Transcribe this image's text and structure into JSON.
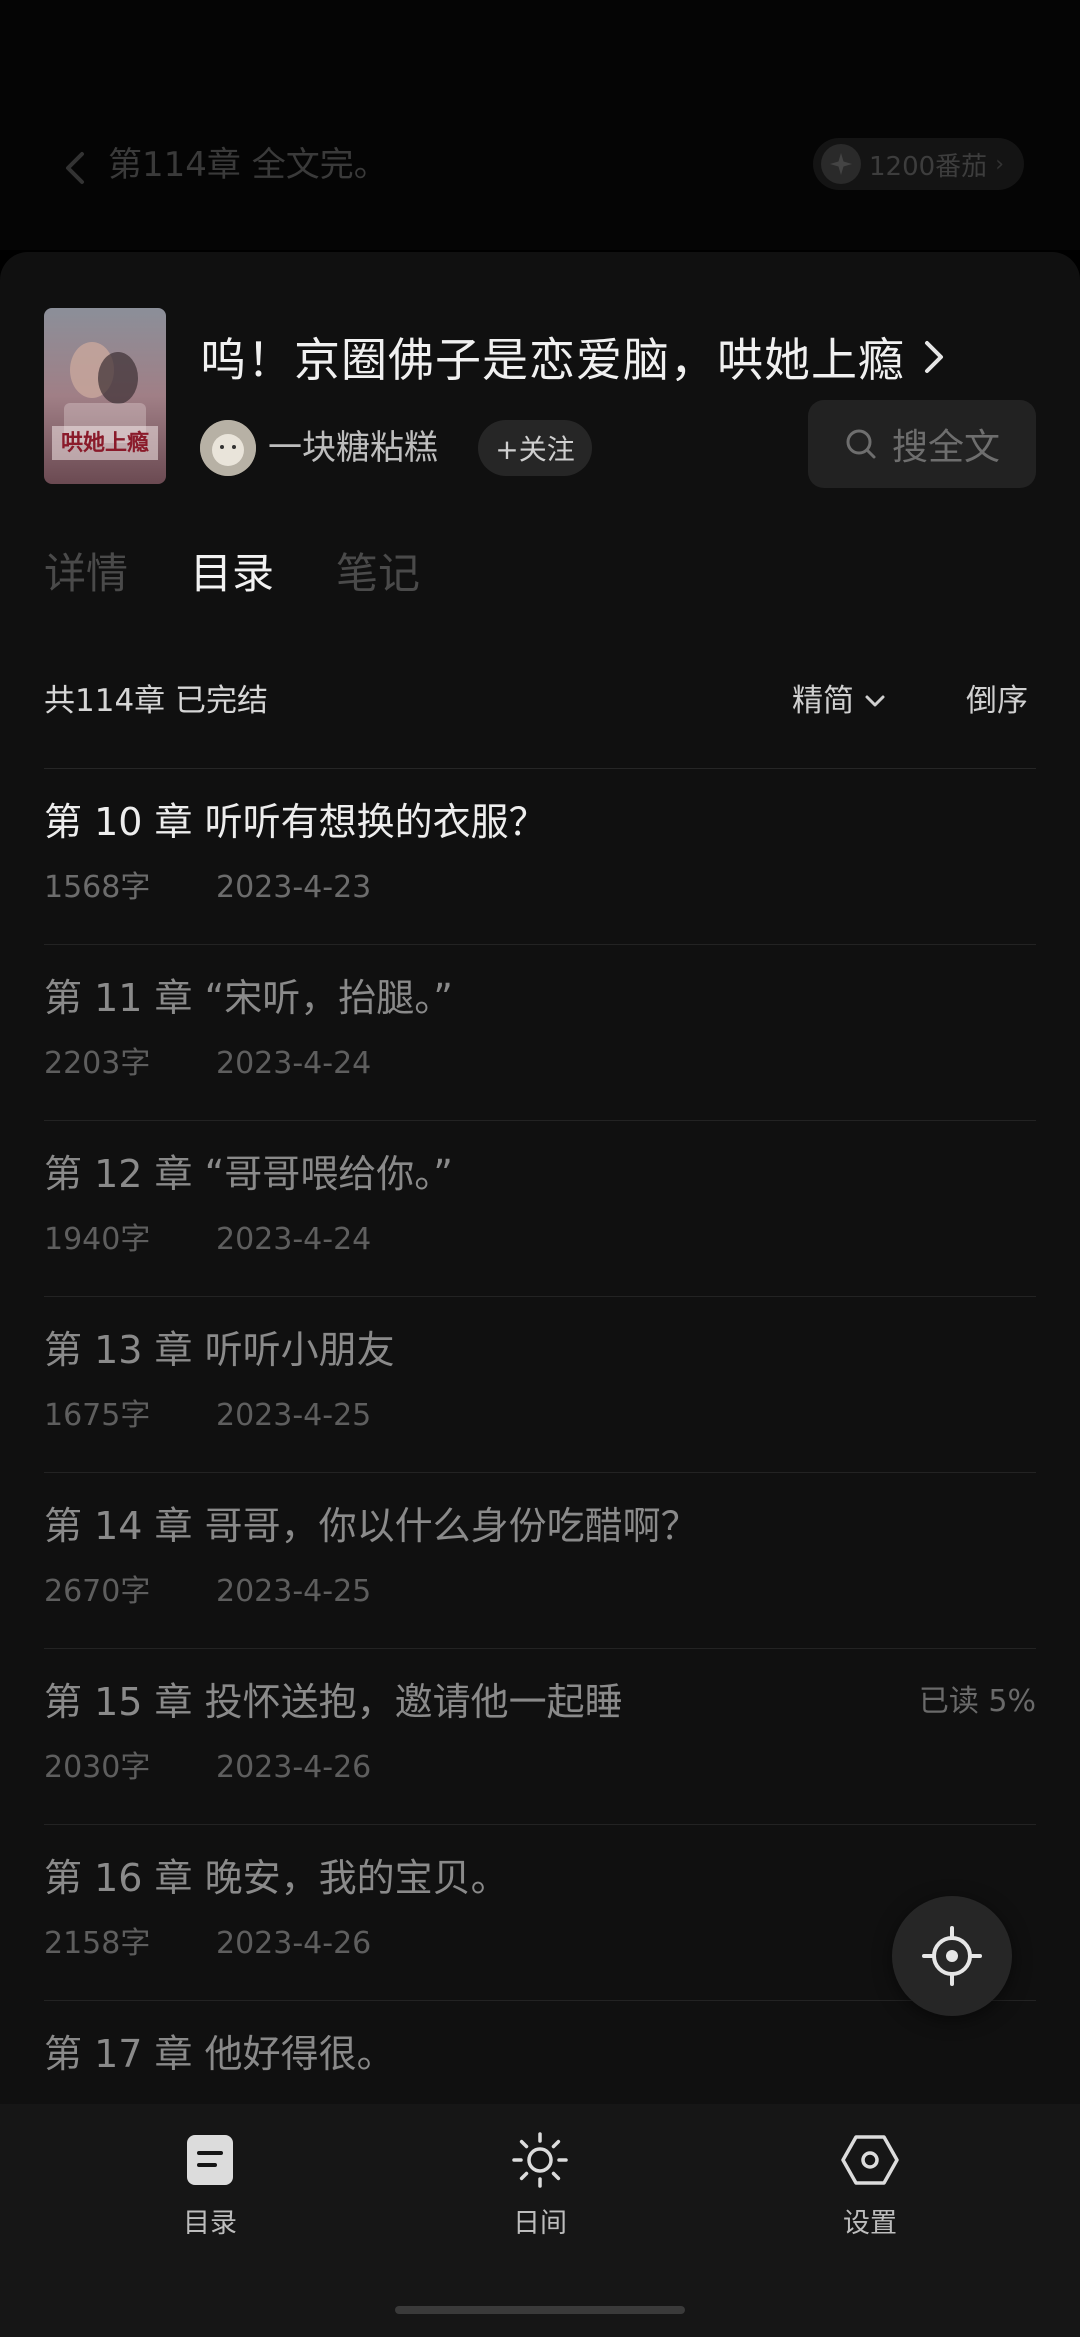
{
  "reader": {
    "title": "第114章 全文完。",
    "points_label": "1200番茄"
  },
  "book": {
    "title": "呜！京圈佛子是恋爱脑，哄她上瘾",
    "cover_text": "哄她上瘾",
    "author": "一块糖粘糕",
    "follow_label": "+关注",
    "search_label": "搜全文"
  },
  "tabs": [
    {
      "label": "详情",
      "active": false
    },
    {
      "label": "目录",
      "active": true
    },
    {
      "label": "笔记",
      "active": false
    }
  ],
  "catalog": {
    "summary": "共114章 已完结",
    "variant_label": "精简",
    "order_label": "倒序"
  },
  "chapters": [
    {
      "title": "第 10 章  听听有想换的衣服？",
      "words": "1568字",
      "date": "2023-4-23",
      "progress": ""
    },
    {
      "title": "第 11 章 “宋听，抬腿。”",
      "words": "2203字",
      "date": "2023-4-24",
      "progress": ""
    },
    {
      "title": "第 12 章 “哥哥喂给你。”",
      "words": "1940字",
      "date": "2023-4-24",
      "progress": ""
    },
    {
      "title": "第 13 章  听听小朋友",
      "words": "1675字",
      "date": "2023-4-25",
      "progress": ""
    },
    {
      "title": "第 14 章  哥哥，你以什么身份吃醋啊？",
      "words": "2670字",
      "date": "2023-4-25",
      "progress": ""
    },
    {
      "title": "第 15 章  投怀送抱，邀请他一起睡",
      "words": "2030字",
      "date": "2023-4-26",
      "progress": "已读 5%"
    },
    {
      "title": "第 16 章  晚安，我的宝贝。",
      "words": "2158字",
      "date": "2023-4-26",
      "progress": ""
    },
    {
      "title": "第 17 章  他好得很。",
      "words": "",
      "date": "",
      "progress": ""
    }
  ],
  "bottom_bar": {
    "catalog_label": "目录",
    "daymode_label": "日间",
    "settings_label": "设置"
  },
  "icons": {
    "back": "chevron-left-icon",
    "points": "sparkle-icon",
    "title_more": "chevron-right-icon",
    "search": "search-icon",
    "sort_variant": "chevron-down-icon",
    "locate": "crosshair-icon",
    "catalog": "catalog-icon",
    "daymode": "sun-icon",
    "settings": "hexagon-settings-icon"
  },
  "colors": {
    "sheet_bg": "#101010",
    "bottom_bar_bg": "#161616",
    "text_primary": "#ededed",
    "text_muted": "#8a8a8a"
  }
}
